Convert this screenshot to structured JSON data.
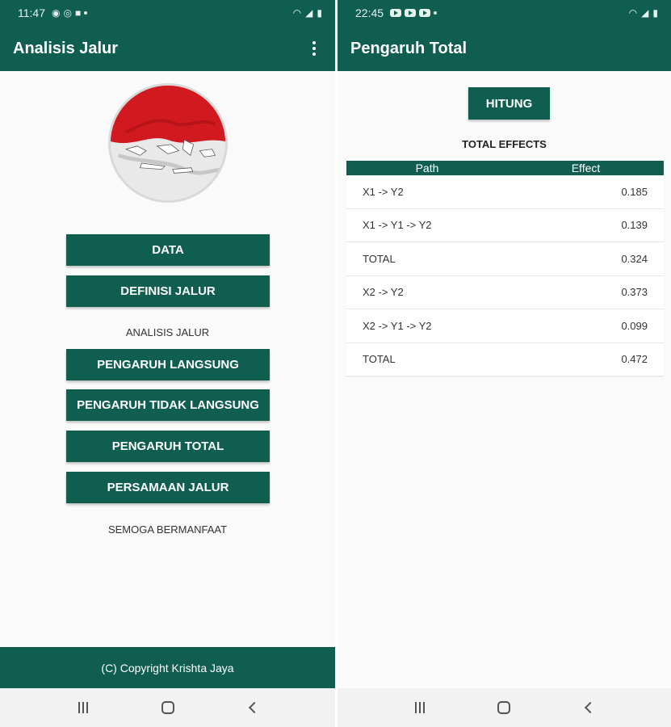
{
  "left": {
    "status": {
      "time": "11:47"
    },
    "appbar": {
      "title": "Analisis Jalur"
    },
    "menu": {
      "data_label": "DATA",
      "definisi_label": "DEFINISI JALUR",
      "analisis_label": "ANALISIS JALUR",
      "langsung_label": "PENGARUH LANGSUNG",
      "tidak_langsung_label": "PENGARUH TIDAK LANGSUNG",
      "total_label": "PENGARUH TOTAL",
      "persamaan_label": "PERSAMAAN JALUR",
      "tagline": "SEMOGA BERMANFAAT"
    },
    "footer": {
      "text": "(C) Copyright Krishta Jaya"
    }
  },
  "right": {
    "status": {
      "time": "22:45"
    },
    "appbar": {
      "title": "Pengaruh Total"
    },
    "hitung_label": "HITUNG",
    "section_title": "TOTAL EFFECTS",
    "table": {
      "headers": [
        "Path",
        "Effect"
      ],
      "rows": [
        {
          "path": "X1 -> Y2",
          "effect": "0.185"
        },
        {
          "path": "X1 -> Y1 -> Y2",
          "effect": "0.139"
        },
        {
          "path": "TOTAL",
          "effect": "0.324"
        },
        {
          "path": "X2 -> Y2",
          "effect": "0.373"
        },
        {
          "path": "X2 -> Y1 -> Y2",
          "effect": "0.099"
        },
        {
          "path": "TOTAL",
          "effect": "0.472"
        }
      ]
    }
  },
  "colors": {
    "primary": "#0f5e4f",
    "background": "#fafafa",
    "flag_red": "#d11a1f"
  }
}
